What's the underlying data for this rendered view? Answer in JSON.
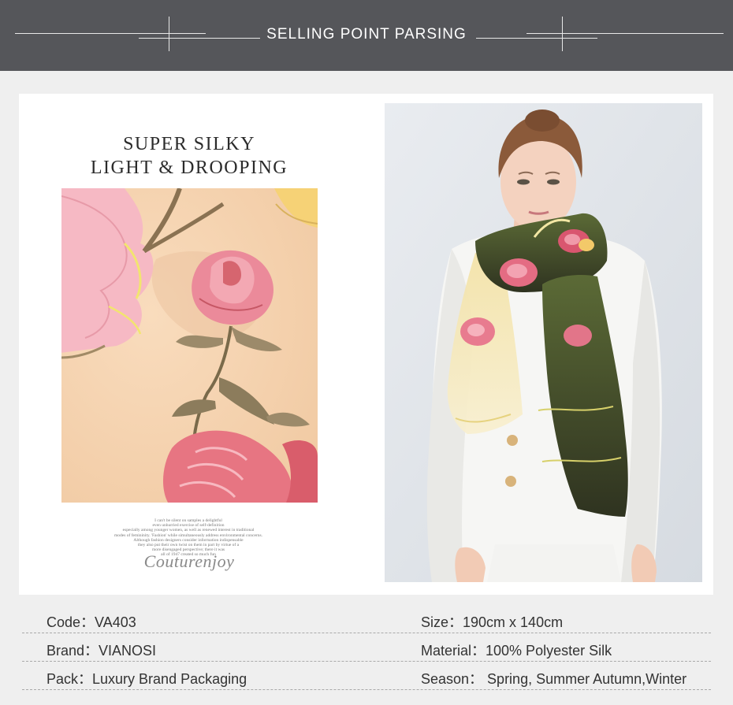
{
  "header": {
    "title": "SELLING POINT PARSING"
  },
  "colors": {
    "header_bg": "#55565a",
    "page_bg": "#efefef",
    "card_bg": "#ffffff",
    "swatch_bg": "#f7d6b5",
    "rose_pink": "#e9707e",
    "scarf_olive": "#4f5b2e"
  },
  "feature": {
    "headline_line1": "SUPER SILKY",
    "headline_line2": "LIGHT & DROOPING",
    "fine_print": [
      "I can't be silent on samples a delightful",
      "even unhurried exercise of self-definition",
      "especially among younger women, as well as renewed interest in traditional",
      "modes of femininity. 'Fashion' while simultaneously address environmental concerns.",
      "Although fashion designers consider information indispensable",
      "they also put their own twist on them in part by virtue of a",
      "more disengaged perspective; there it was",
      "all of 1947 created so much fun"
    ],
    "signature": "Couturenjoy"
  },
  "specs": [
    {
      "left": "Code：VA403",
      "right": "Size：190cm x 140cm"
    },
    {
      "left": "Brand：VIANOSI",
      "right": "Material：100% Polyester Silk"
    },
    {
      "left": "Pack：Luxury Brand Packaging",
      "right": "Season： Spring, Summer Autumn,Winter"
    }
  ]
}
